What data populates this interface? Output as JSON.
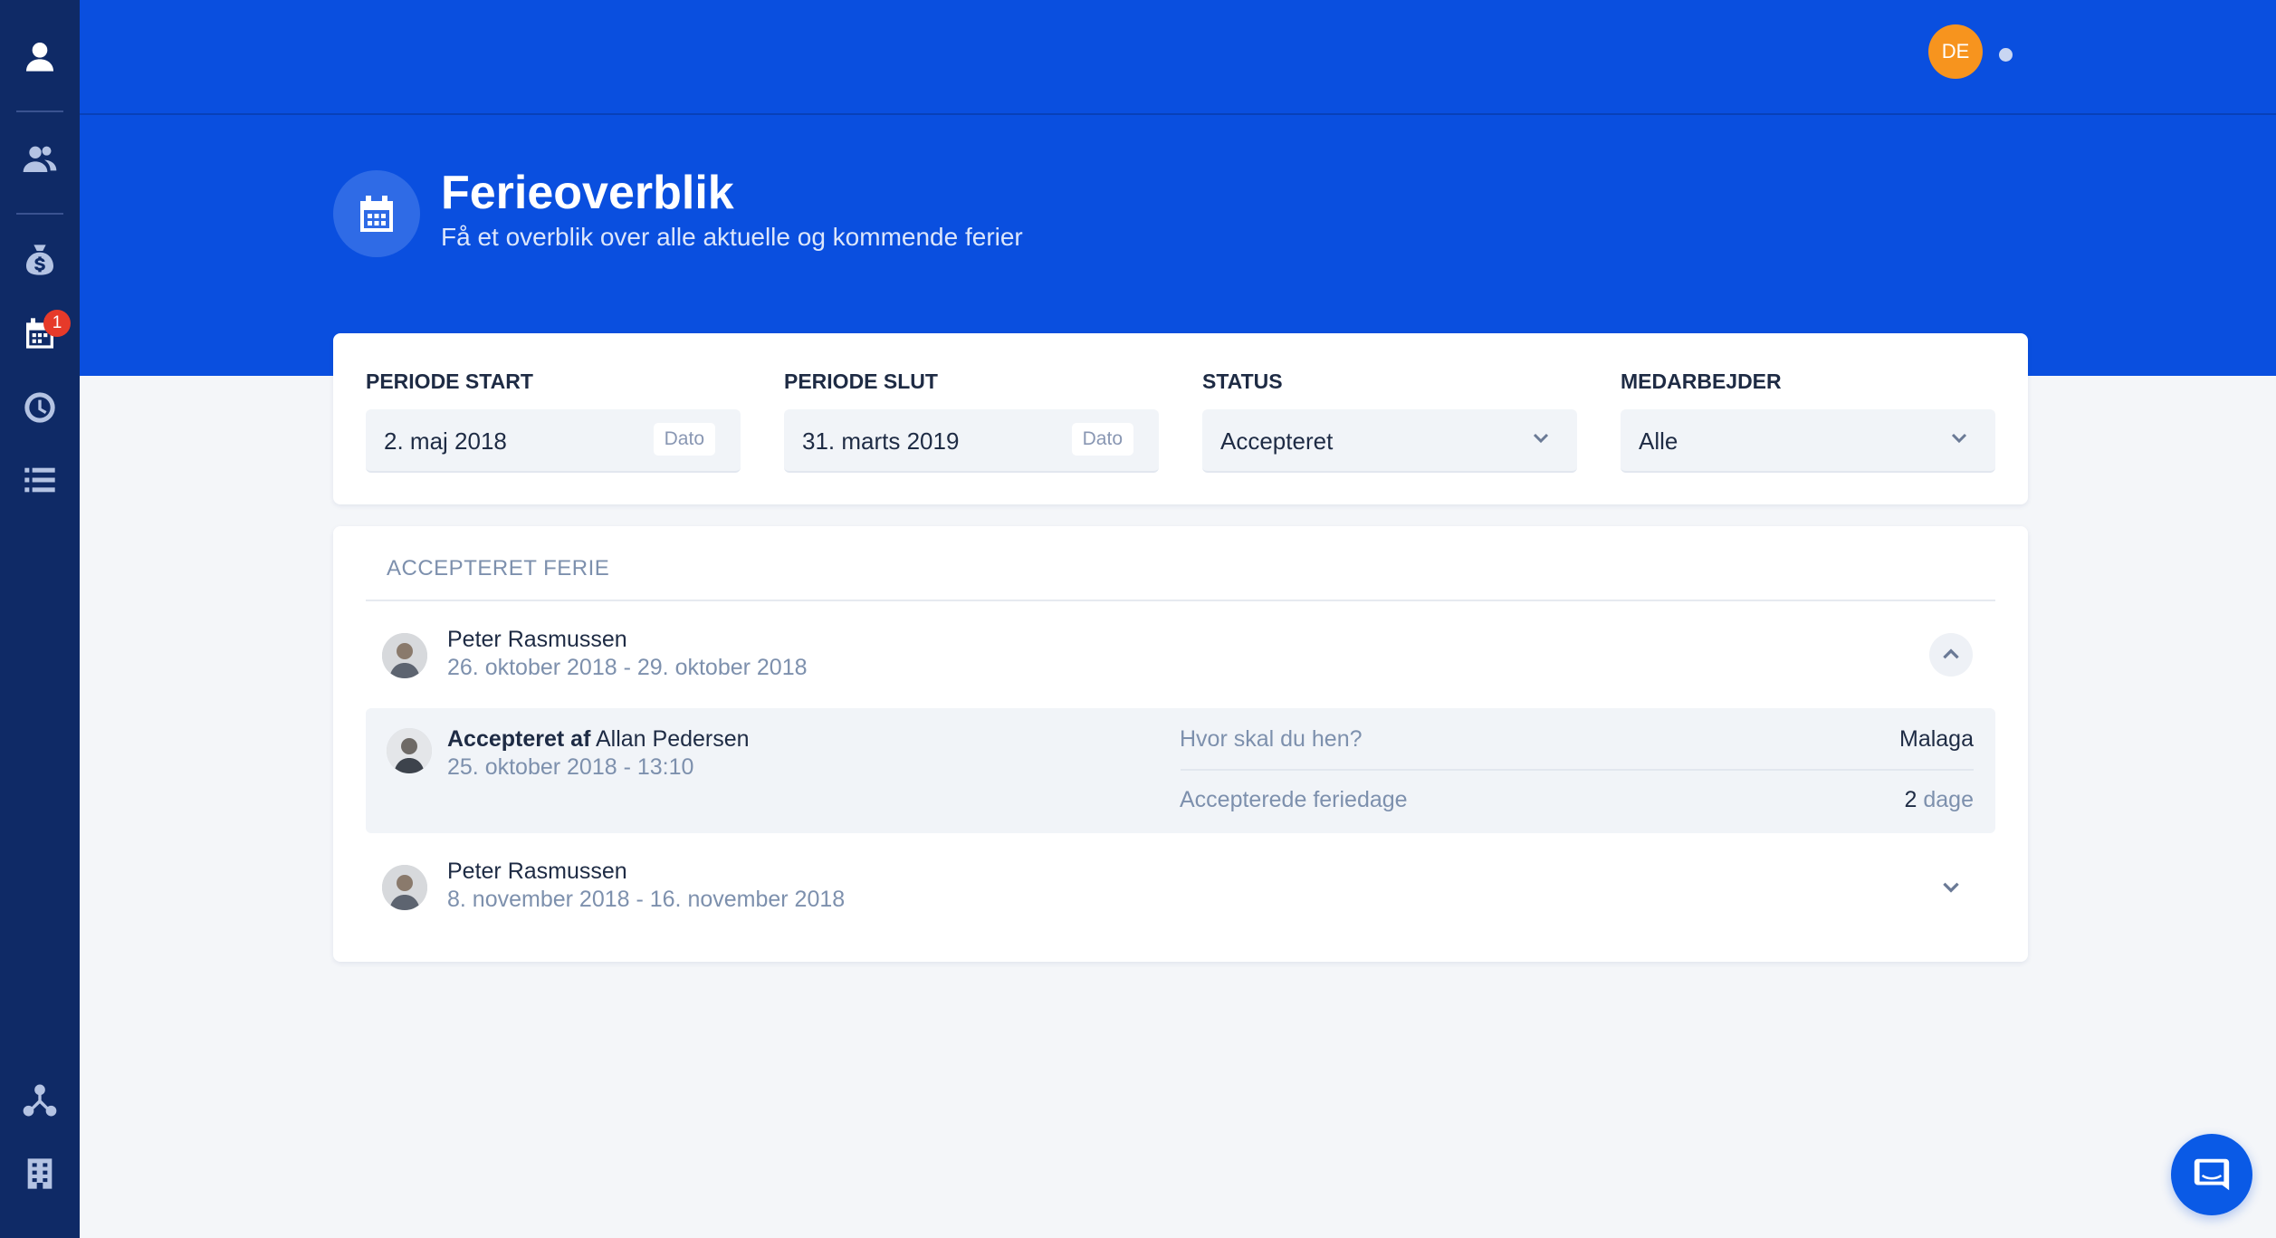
{
  "header": {
    "user_initials": "DE",
    "title": "Ferieoverblik",
    "subtitle": "Få et overblik over alle aktuelle og kommende ferier"
  },
  "sidebar": {
    "items": [
      {
        "icon": "user-icon"
      },
      {
        "icon": "users-icon"
      },
      {
        "icon": "money-bag-icon"
      },
      {
        "icon": "calendar-icon",
        "badge": "1",
        "active": true
      },
      {
        "icon": "clock-icon"
      },
      {
        "icon": "list-icon"
      },
      {
        "icon": "org-chart-icon"
      },
      {
        "icon": "building-icon"
      }
    ]
  },
  "filters": {
    "period_start": {
      "label": "PERIODE START",
      "value": "2. maj 2018",
      "tag": "Dato"
    },
    "period_end": {
      "label": "PERIODE SLUT",
      "value": "31. marts 2019",
      "tag": "Dato"
    },
    "status": {
      "label": "STATUS",
      "value": "Accepteret"
    },
    "employee": {
      "label": "MEDARBEJDER",
      "value": "Alle"
    }
  },
  "list": {
    "section_title": "ACCEPTERET FERIE",
    "entries": [
      {
        "name": "Peter Rasmussen",
        "dates": "26. oktober 2018 - 29. oktober 2018",
        "expanded": true,
        "detail": {
          "accepted_prefix": "Accepteret af",
          "accepted_by": "Allan Pedersen",
          "accepted_at": "25. oktober 2018 - 13:10",
          "destination_label": "Hvor skal du hen?",
          "destination_value": "Malaga",
          "days_label": "Accepterede feriedage",
          "days_value": "2",
          "days_unit": "dage"
        }
      },
      {
        "name": "Peter Rasmussen",
        "dates": "8. november 2018 - 16. november 2018",
        "expanded": false
      }
    ]
  },
  "colors": {
    "header_blue": "#0a4fdf",
    "sidebar_navy": "#0f2a66",
    "avatar_orange": "#f7941e",
    "badge_red": "#e63a2a"
  }
}
